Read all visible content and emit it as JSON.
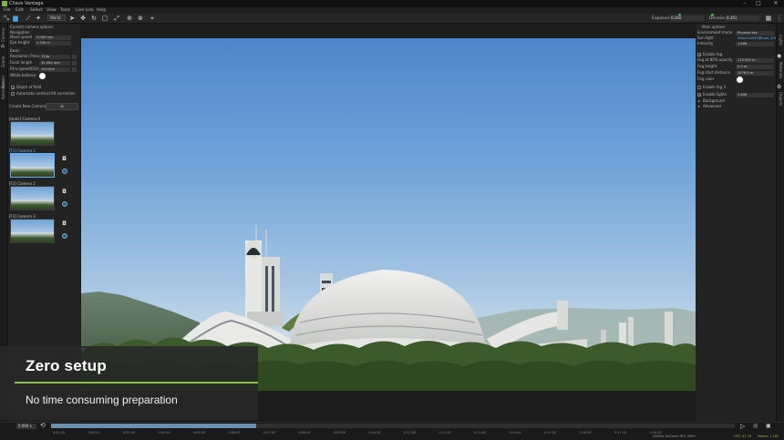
{
  "window": {
    "title": "Chaos Vantage",
    "controls": {
      "minimize": "–",
      "maximize": "□",
      "close": "✕"
    }
  },
  "menu": [
    "File",
    "Edit",
    "Select",
    "View",
    "Tools",
    "Live Link",
    "Help"
  ],
  "toolbar": {
    "select_mode": "World",
    "exposure_label": "Exposure",
    "exposure_value": "0.260",
    "denoise_label": "Denoise",
    "denoise_value": "0.261"
  },
  "left_tabs": [
    "Camera",
    "Scene",
    "Render",
    "Animation"
  ],
  "camera_panel": {
    "section_current": "Current camera options",
    "navigation": "Navigation",
    "move_speed_label": "Move speed",
    "move_speed_value": "5.000 m/s",
    "eye_height_label": "Eye height",
    "eye_height_value": "1.700 m",
    "basic": "Basic",
    "resolution_label": "Resolution Preset",
    "resolution_value": "720p",
    "focal_label": "Focal length",
    "focal_value": "35.000 mm",
    "film_label": "Film speed(ISO)",
    "film_value": "100.000",
    "white_balance_label": "White balance",
    "dof_label": "Depth of field",
    "vertical_tilt_label": "Automatic vertical tilt correction",
    "create_camera_label": "Create New Camera",
    "cameras": [
      {
        "label": "[main] Camera 0"
      },
      {
        "label": "[F1] Camera 1"
      },
      {
        "label": "[F2] Camera 2"
      },
      {
        "label": "[F3] Camera 3"
      }
    ]
  },
  "right_tabs": [
    "Lights",
    "Materials",
    "Objects"
  ],
  "right_panel": {
    "main_options": "Main options",
    "env_mode_label": "Environment mode",
    "env_mode_value": "Physical sky",
    "sun_light_label": "Sun light",
    "sun_light_value": "VRaySunSKY@light_SUN",
    "intensity_label": "Intensity",
    "intensity_value": "1.806",
    "enable_fog_label": "Enable fog",
    "fog_opacity_label": "Fog at 80% opacity",
    "fog_opacity_value": "175.590 m",
    "fog_height_label": "Fog height",
    "fog_height_value": "0.0 m",
    "fog_start_label": "Fog start distance",
    "fog_start_value": "2076.0 m",
    "fog_color_label": "Fog color",
    "enable_fog_lights_label": "Enable fog li",
    "enable_lights_label": "Enable lights",
    "lights_value": "1.806",
    "background_label": "Background",
    "advanced_label": "Advanced"
  },
  "timeline": {
    "current_time": "5.000 s",
    "ticks": [
      "0:01.00",
      "0:02.00",
      "0:03.00",
      "0:04.00",
      "0:05.00",
      "0:06.00",
      "0:07.00",
      "0:08.00",
      "0:09.00",
      "0:10.00",
      "0:11.00",
      "0:12.00",
      "0:13.00",
      "0:14.00",
      "0:15.00",
      "0:16.00",
      "0:17.00",
      "0:18.00"
    ],
    "progress": 0.3
  },
  "status": {
    "gpu": "NVIDIA GeForce RTX 3090",
    "fps": "FPS: 37.70",
    "model": "Model: 1.280"
  },
  "caption": {
    "title": "Zero setup",
    "subtitle": "No time consuming preparation"
  },
  "colors": {
    "accent": "#8bc34a",
    "link": "#5fb3ff",
    "sky_top": "#4c86c9"
  }
}
